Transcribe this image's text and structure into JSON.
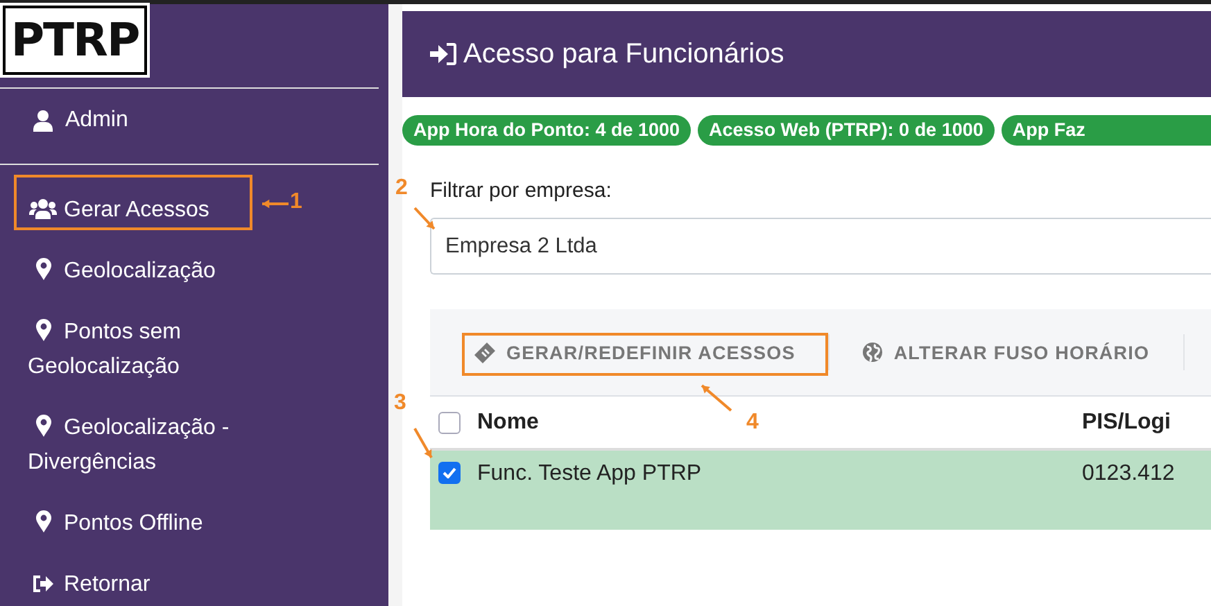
{
  "sidebar": {
    "logo": "PTRP",
    "user": {
      "label": "Admin",
      "kind": "user"
    },
    "items": [
      {
        "label": "Gerar Acessos",
        "kind": "users"
      },
      {
        "label": "Geolocalização",
        "kind": "pin"
      },
      {
        "label": "Pontos sem Geolocalização",
        "kind": "pin"
      },
      {
        "label": "Geolocalização - Divergências",
        "kind": "pin"
      },
      {
        "label": "Pontos Offline",
        "kind": "pin"
      },
      {
        "label": "Retornar",
        "kind": "exit"
      }
    ]
  },
  "header": {
    "title": "Acesso para Funcionários"
  },
  "badges": [
    "App Hora do Ponto: 4 de 1000",
    "Acesso Web (PTRP): 0 de 1000",
    "App Faz"
  ],
  "filter": {
    "label": "Filtrar por empresa:",
    "value": "Empresa 2 Ltda"
  },
  "toolbar": [
    {
      "label": "GERAR/REDEFINIR ACESSOS",
      "kind": "tag"
    },
    {
      "label": "ALTERAR FUSO HORÁRIO",
      "kind": "globe"
    }
  ],
  "table": {
    "select_all": {
      "checked": false
    },
    "columns": [
      "Nome",
      "PIS/Logi"
    ],
    "rows": [
      {
        "checked": true,
        "cells": [
          "Func. Teste App PTRP",
          "0123.412"
        ]
      }
    ]
  },
  "annotations": [
    "1",
    "2",
    "3",
    "4"
  ]
}
